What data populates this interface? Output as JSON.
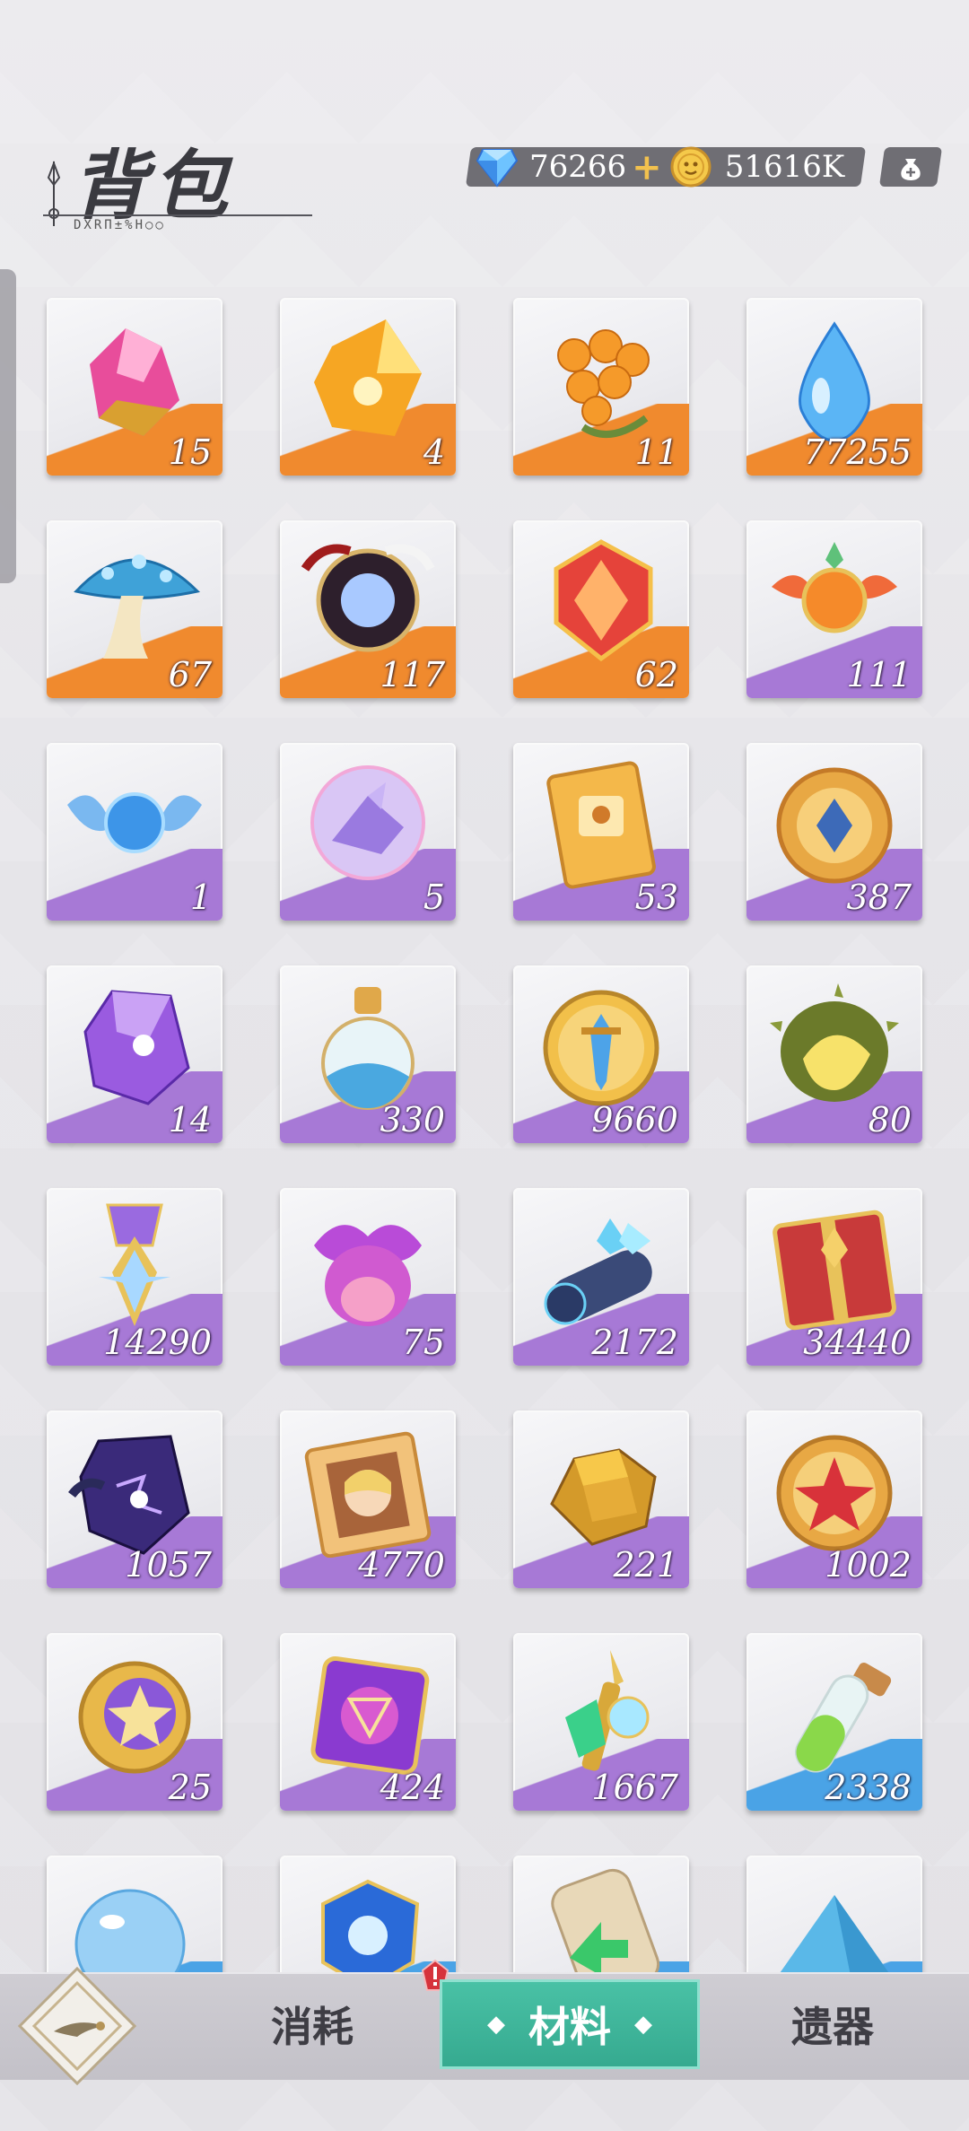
{
  "header": {
    "title": "背包",
    "subtitle": "DXRΠ±%H○○",
    "gems": "76266",
    "plus": "+",
    "coins": "51616K"
  },
  "colors": {
    "orange_band": "#f08a2e",
    "purple_band": "#a779d6",
    "blue_band": "#4aa3e6",
    "active_tab": "#3fb79b"
  },
  "items": [
    {
      "name": "pink-crystal-icon",
      "count": "15",
      "rarity": "orange"
    },
    {
      "name": "gold-crystal-icon",
      "count": "4",
      "rarity": "orange"
    },
    {
      "name": "orange-berries-icon",
      "count": "11",
      "rarity": "orange"
    },
    {
      "name": "water-drop-icon",
      "count": "77255",
      "rarity": "orange"
    },
    {
      "name": "blue-mushroom-icon",
      "count": "67",
      "rarity": "orange"
    },
    {
      "name": "dark-orb-icon",
      "count": "117",
      "rarity": "orange"
    },
    {
      "name": "red-gem-icon",
      "count": "62",
      "rarity": "orange"
    },
    {
      "name": "winged-flame-orb-icon",
      "count": "111",
      "rarity": "purple"
    },
    {
      "name": "winged-blue-orb-icon",
      "count": "1",
      "rarity": "purple"
    },
    {
      "name": "paper-crane-orb-icon",
      "count": "5",
      "rarity": "purple"
    },
    {
      "name": "gold-ticket-icon",
      "count": "53",
      "rarity": "purple"
    },
    {
      "name": "gold-medal-icon",
      "count": "387",
      "rarity": "purple"
    },
    {
      "name": "purple-crystal-icon",
      "count": "14",
      "rarity": "purple"
    },
    {
      "name": "blue-sand-potion-icon",
      "count": "330",
      "rarity": "purple"
    },
    {
      "name": "sword-coin-icon",
      "count": "9660",
      "rarity": "purple"
    },
    {
      "name": "durian-icon",
      "count": "80",
      "rarity": "purple"
    },
    {
      "name": "star-medal-icon",
      "count": "14290",
      "rarity": "purple"
    },
    {
      "name": "purple-flower-icon",
      "count": "75",
      "rarity": "purple"
    },
    {
      "name": "crystal-log-icon",
      "count": "2172",
      "rarity": "purple"
    },
    {
      "name": "red-gift-box-icon",
      "count": "34440",
      "rarity": "purple"
    },
    {
      "name": "dark-purple-gem-icon",
      "count": "1057",
      "rarity": "purple"
    },
    {
      "name": "character-ticket-icon",
      "count": "4770",
      "rarity": "purple"
    },
    {
      "name": "gold-ore-icon",
      "count": "221",
      "rarity": "purple"
    },
    {
      "name": "red-star-coin-icon",
      "count": "1002",
      "rarity": "purple"
    },
    {
      "name": "purple-star-coin-icon",
      "count": "25",
      "rarity": "purple"
    },
    {
      "name": "violet-rune-stone-icon",
      "count": "424",
      "rarity": "purple"
    },
    {
      "name": "green-crystal-staff-icon",
      "count": "1667",
      "rarity": "purple"
    },
    {
      "name": "green-potion-tube-icon",
      "count": "2338",
      "rarity": "blue"
    },
    {
      "name": "blue-bubble-icon",
      "count": "",
      "rarity": "blue"
    },
    {
      "name": "blue-cube-gem-icon",
      "count": "",
      "rarity": "blue"
    },
    {
      "name": "scroll-arrow-icon",
      "count": "",
      "rarity": "blue"
    },
    {
      "name": "blue-sand-pile-icon",
      "count": "",
      "rarity": "blue"
    }
  ],
  "tabs": {
    "consume": "消耗",
    "material": "材料",
    "relic": "遗器",
    "active": "material"
  }
}
